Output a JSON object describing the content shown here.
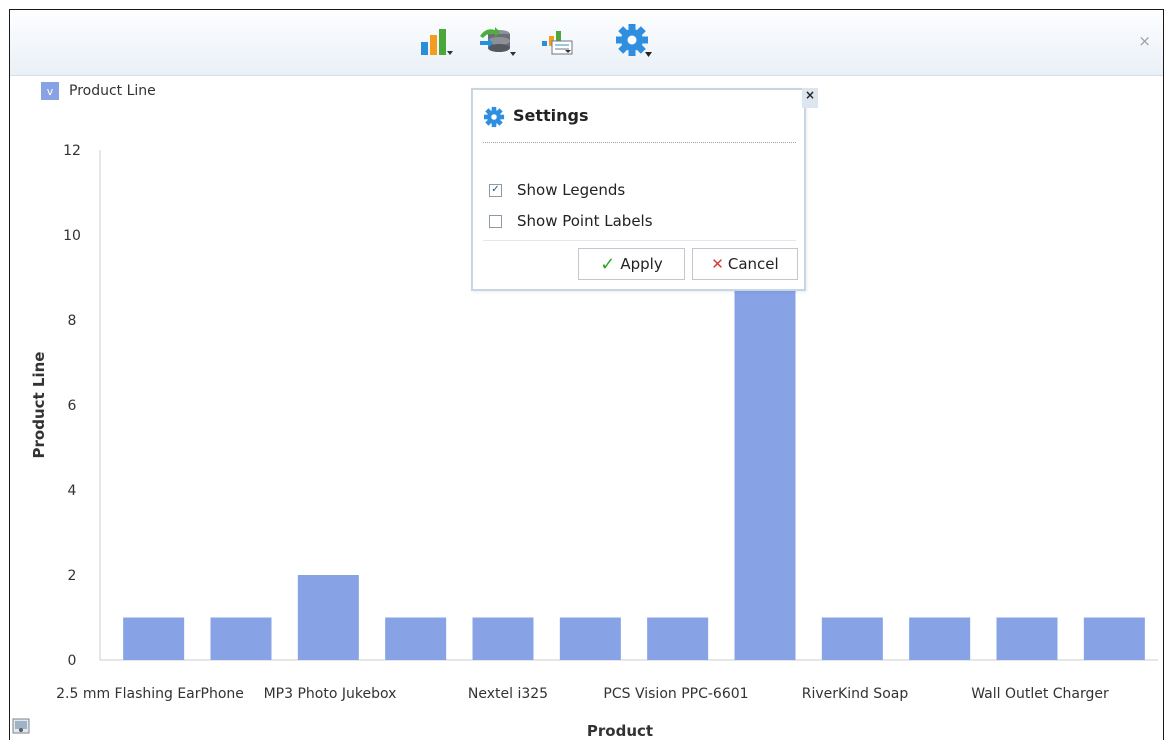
{
  "toolbar": {
    "icons": [
      "bar-chart-icon",
      "data-source-icon",
      "chart-options-icon",
      "gear-icon"
    ],
    "close_label": "×"
  },
  "legend": {
    "label": "Product Line",
    "checked": true,
    "check_glyph": "v",
    "color": "#87a3e6"
  },
  "settings": {
    "title": "Settings",
    "close_label": "×",
    "options": [
      {
        "label": "Show Legends",
        "checked": true
      },
      {
        "label": "Show Point Labels",
        "checked": false
      }
    ],
    "apply_label": "Apply",
    "cancel_label": "Cancel",
    "check_glyph": "✓",
    "apply_glyph": "✓",
    "cancel_glyph": "✕"
  },
  "chart_data": {
    "type": "bar",
    "categories": [
      "2.5 mm Flashing EarPhone",
      "MP3 Photo Jukebox",
      "",
      "",
      "Nextel i325",
      "",
      "PCS Vision PPC-6601",
      "",
      "RiverKind Soap",
      "",
      "Wall Outlet Charger",
      ""
    ],
    "values": [
      1,
      1,
      2,
      1,
      1,
      1,
      1,
      9,
      1,
      1,
      1,
      1
    ],
    "x_labels": [
      "2.5 mm Flashing EarPhone",
      "MP3 Photo Jukebox",
      "Nextel i325",
      "PCS Vision PPC-6601",
      "RiverKind Soap",
      "Wall Outlet Charger"
    ],
    "xlabel": "Product",
    "ylabel": "Product Line",
    "ylim": [
      0,
      12
    ],
    "yticks": [
      0,
      2,
      4,
      6,
      8,
      10,
      12
    ],
    "series_color": "#87a3e6",
    "grid": false,
    "legend": "top-left"
  }
}
